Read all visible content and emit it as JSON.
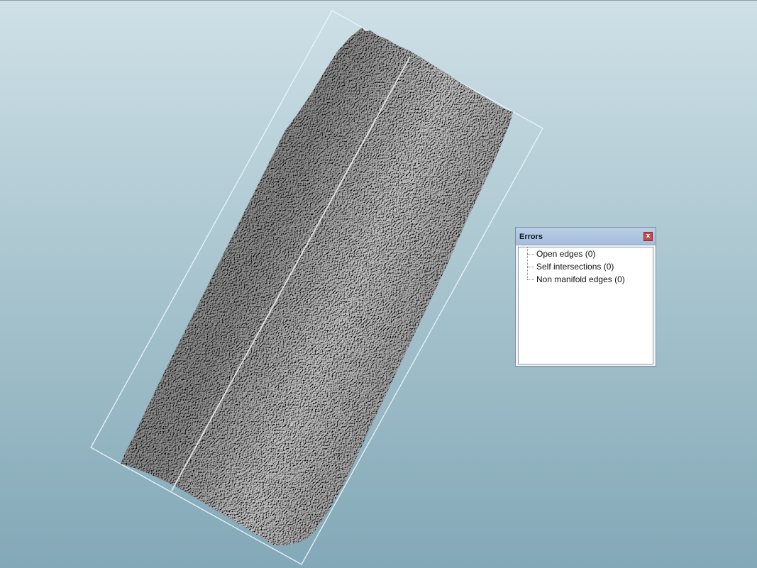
{
  "errors_panel": {
    "title": "Errors",
    "close_label": "x",
    "items": [
      {
        "label": "Open edges (0)"
      },
      {
        "label": "Self intersections (0)"
      },
      {
        "label": "Non manifold edges (0)"
      }
    ]
  },
  "colors": {
    "background_top": "#cfe0e7",
    "background_bottom": "#83a8b7",
    "mesh_gray": "#6e6e6e",
    "bounding_box": "#e8f4fa",
    "panel_title_bar": "#a4bddb",
    "close_button": "#c74b4b"
  }
}
